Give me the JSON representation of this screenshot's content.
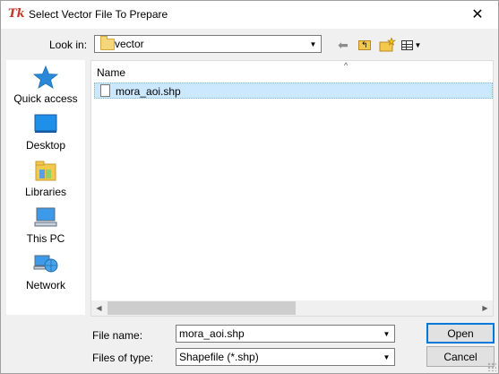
{
  "window": {
    "title": "Select Vector File To Prepare",
    "app_icon_text": "Tk",
    "close_glyph": "✕"
  },
  "lookin": {
    "label": "Look in:",
    "value": "vector",
    "icons": [
      "back-arrow-icon",
      "up-folder-icon",
      "new-folder-icon",
      "view-menu-icon"
    ]
  },
  "places": [
    {
      "label": "Quick access",
      "icon": "star-icon"
    },
    {
      "label": "Desktop",
      "icon": "desktop-icon"
    },
    {
      "label": "Libraries",
      "icon": "libraries-icon"
    },
    {
      "label": "This PC",
      "icon": "computer-icon"
    },
    {
      "label": "Network",
      "icon": "network-icon"
    }
  ],
  "filelist": {
    "column_name": "Name",
    "files": [
      {
        "name": "mora_aoi.shp",
        "selected": true
      }
    ]
  },
  "filename": {
    "label": "File name:",
    "value": "mora_aoi.shp"
  },
  "filetype": {
    "label": "Files of type:",
    "value": "Shapefile (*.shp)"
  },
  "buttons": {
    "open": "Open",
    "cancel": "Cancel"
  },
  "colors": {
    "selection": "#cce8ff",
    "accent": "#0078d7"
  }
}
